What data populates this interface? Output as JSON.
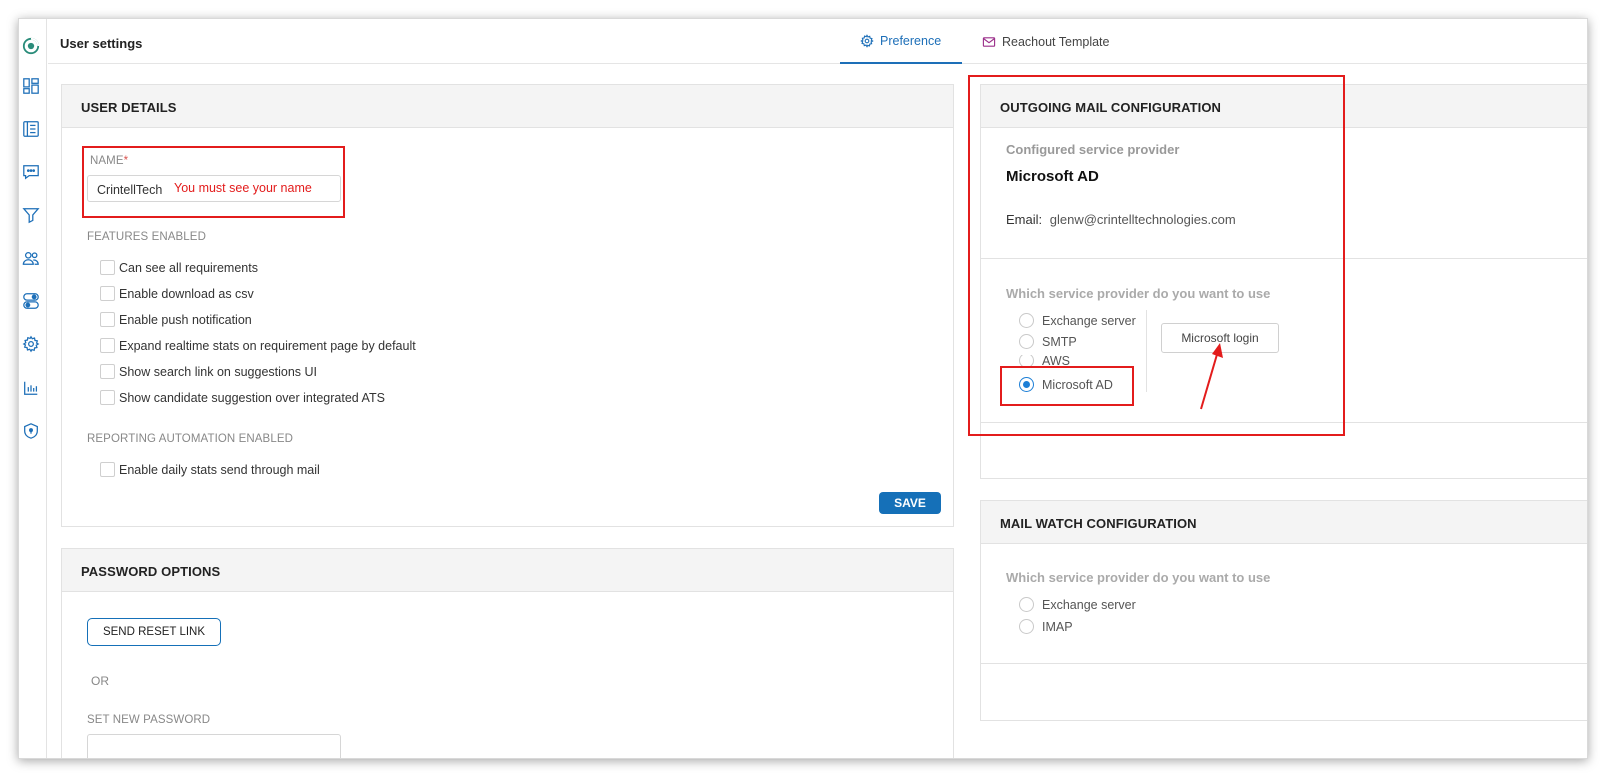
{
  "header": {
    "title": "User settings"
  },
  "tabs": [
    {
      "label": "Preference",
      "icon": "gear-icon",
      "active": true
    },
    {
      "label": "Reachout Template",
      "icon": "mail-icon",
      "active": false
    }
  ],
  "sidebar": {
    "icons": [
      "logo-icon",
      "dashboard-icon",
      "list-icon",
      "chat-icon",
      "filter-icon",
      "users-icon",
      "toggle-icon",
      "settings-icon",
      "bar-chart-icon",
      "shield-icon"
    ]
  },
  "user_details": {
    "title": "USER DETAILS",
    "name_label": "NAME",
    "name_required": "*",
    "name_value": "CrintellTech",
    "name_annotation": "You must see your name",
    "features_label": "FEATURES ENABLED",
    "features": [
      {
        "label": "Can see all requirements",
        "checked": false
      },
      {
        "label": "Enable download as csv",
        "checked": false
      },
      {
        "label": "Enable push notification",
        "checked": false
      },
      {
        "label": "Expand realtime stats on requirement page by default",
        "checked": false
      },
      {
        "label": "Show search link on suggestions UI",
        "checked": false
      },
      {
        "label": "Show candidate suggestion over integrated ATS",
        "checked": false
      }
    ],
    "reporting_label": "REPORTING AUTOMATION ENABLED",
    "reporting": [
      {
        "label": "Enable daily stats send through mail",
        "checked": false
      }
    ],
    "save_label": "SAVE"
  },
  "password_options": {
    "title": "PASSWORD OPTIONS",
    "reset_link_label": "SEND RESET LINK",
    "or_label": "OR",
    "new_password_label": "SET NEW PASSWORD"
  },
  "outgoing_mail": {
    "title": "OUTGOING MAIL CONFIGURATION",
    "configured_label": "Configured service provider",
    "configured_value": "Microsoft AD",
    "email_label": "Email:",
    "email_value": "glenw@crintelltechnologies.com",
    "question": "Which service provider do you want to use",
    "options": [
      "Exchange server",
      "SMTP",
      "AWS",
      "Microsoft AD"
    ],
    "selected": "Microsoft AD",
    "login_button": "Microsoft login"
  },
  "mail_watch": {
    "title": "MAIL WATCH CONFIGURATION",
    "question": "Which service provider do you want to use",
    "options": [
      "Exchange server",
      "IMAP"
    ]
  },
  "colors": {
    "accent": "#1570b8",
    "annotation": "#e31c1c",
    "header_bg": "#f4f4f4"
  }
}
